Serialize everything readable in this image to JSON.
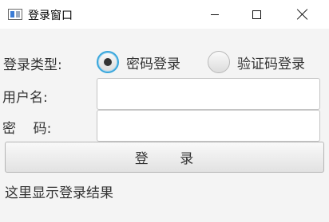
{
  "window": {
    "title": "登录窗口"
  },
  "form": {
    "login_type_label": "登录类型:",
    "username_label": "用户名:",
    "password_label": "密    码:",
    "login_types": [
      {
        "label": "密码登录",
        "selected": true
      },
      {
        "label": "验证码登录",
        "selected": false
      }
    ],
    "username_value": "",
    "password_value": "",
    "login_button_label": "登      录",
    "result_text": "这里显示登录结果"
  },
  "colors": {
    "radio_selected_ring": "#3aa7dc",
    "background": "#f4f4f4"
  }
}
